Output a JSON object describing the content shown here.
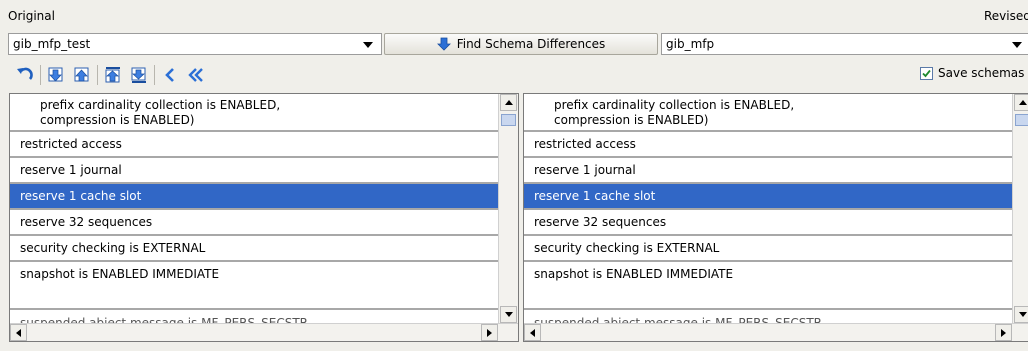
{
  "original": {
    "label": "Original",
    "schema": "gib_mfp_test"
  },
  "revised": {
    "label": "Revised",
    "schema": "gib_mfp"
  },
  "find_button": {
    "label": "Find Schema Differences"
  },
  "save": {
    "label": "Save schemas",
    "checked": true
  },
  "toolbar": {
    "icons": [
      "undo-icon",
      "next-difference-icon",
      "previous-difference-icon",
      "first-difference-icon",
      "last-difference-icon",
      "copy-left-icon",
      "copy-all-left-icon"
    ]
  },
  "left_rows": [
    "prefix cardinality collection is ENABLED,",
    "compression is ENABLED)",
    "restricted access",
    "reserve 1 journal",
    "reserve 1 cache slot",
    "reserve 32 sequences",
    "security checking is EXTERNAL",
    "snapshot is ENABLED IMMEDIATE",
    "suspended abject message is MF_PERS_SECSTR"
  ],
  "right_rows": [
    "prefix cardinality collection is ENABLED,",
    "compression is ENABLED)",
    "restricted access",
    "reserve 1 journal",
    "reserve 1 cache slot",
    "reserve 32 sequences",
    "security checking is EXTERNAL",
    "snapshot is ENABLED IMMEDIATE",
    "suspended abject message is MF_PERS_SECSTR"
  ],
  "colors": {
    "selection": "#3167c6",
    "accent_arrow": "#2b6fd6"
  }
}
